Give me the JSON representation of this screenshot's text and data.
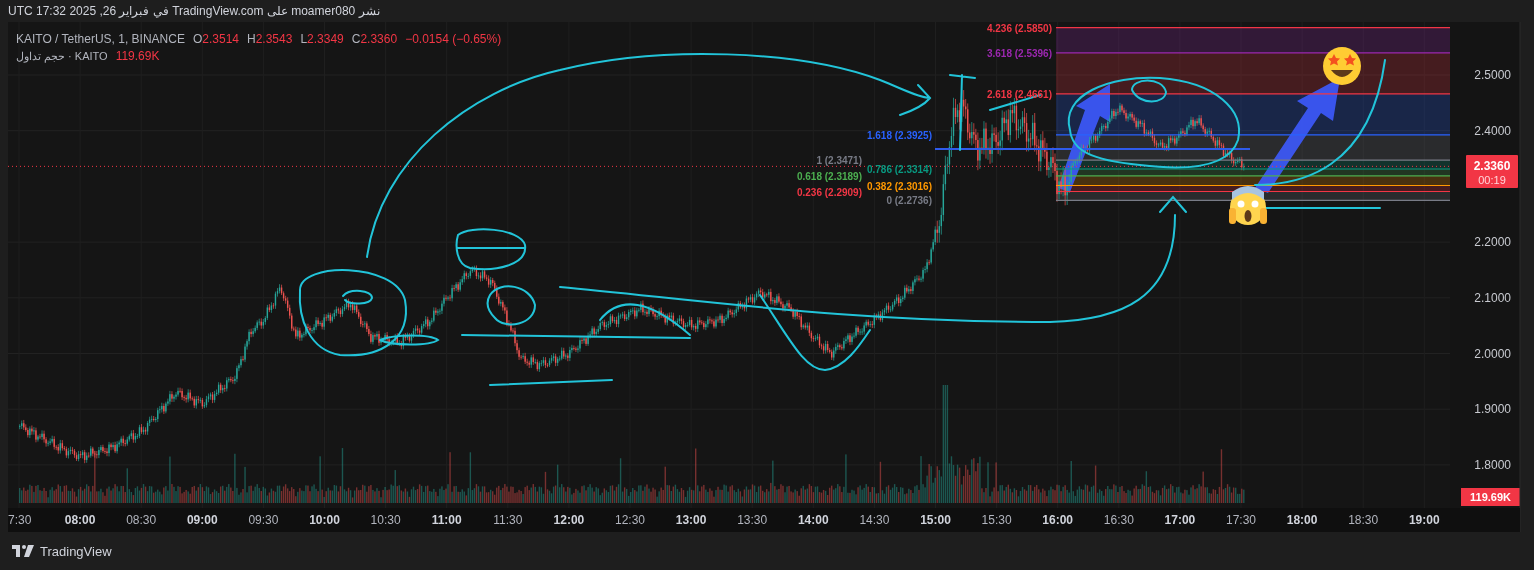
{
  "header": {
    "published": "نشر moamer080 على TradingView.com في فبراير 26, 2025 17:32 UTC"
  },
  "legend": {
    "symbol": "KAITO / TetherUS, 1, BINANCE",
    "ohlc": [
      {
        "key": "O",
        "value": "2.3514"
      },
      {
        "key": "H",
        "value": "2.3543"
      },
      {
        "key": "L",
        "value": "2.3349"
      },
      {
        "key": "C",
        "value": "2.3360"
      }
    ],
    "change": "−0.0154 (−0.65%)",
    "volume_label": "حجم تداول · KAITO",
    "volume_value": "119.69K"
  },
  "chart": {
    "fib_levels": [
      {
        "label": "4.236 (2.5850)",
        "color": "#f23645"
      },
      {
        "label": "3.618 (2.5396)",
        "color": "#9c27b0"
      },
      {
        "label": "2.618 (2.4661)",
        "color": "#f23645"
      },
      {
        "label": "1.618 (2.3925)",
        "color": "#2962ff"
      },
      {
        "label": "1 (2.3471)",
        "color": "#787b86"
      },
      {
        "label": "0.786 (2.3314)",
        "color": "#089981"
      },
      {
        "label": "0.618 (2.3189)",
        "color": "#4caf50"
      },
      {
        "label": "0.382 (2.3016)",
        "color": "#ff9800"
      },
      {
        "label": "0.236 (2.2909)",
        "color": "#f23645"
      },
      {
        "label": "0 (2.2736)",
        "color": "#787b86"
      }
    ],
    "price_axis": [
      "2.5000",
      "2.4000",
      "2.2000",
      "2.1000",
      "2.0000",
      "1.9000",
      "1.8000"
    ],
    "price_tag": {
      "price": "2.3360",
      "countdown": "00:19"
    },
    "volume_tag": "119.69K",
    "time_axis": [
      "7:30",
      "08:00",
      "08:30",
      "09:00",
      "09:30",
      "10:00",
      "10:30",
      "11:00",
      "11:30",
      "12:00",
      "12:30",
      "13:00",
      "13:30",
      "14:00",
      "14:30",
      "15:00",
      "15:30",
      "16:00",
      "16:30",
      "17:00",
      "17:30",
      "18:00",
      "18:30",
      "19:00"
    ]
  },
  "footer": {
    "logo_text": "TradingView"
  }
}
